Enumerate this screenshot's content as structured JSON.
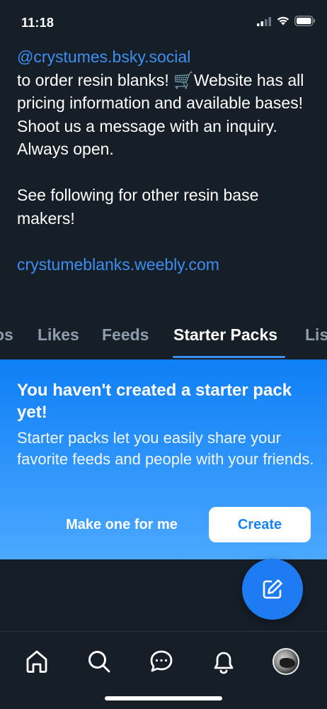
{
  "status_bar": {
    "time": "11:18"
  },
  "bio": {
    "handle_link": "@crystumes.bsky.social",
    "line1": " to order resin blanks! 🛒Website has all pricing information and available bases! Shoot us a message with an inquiry. Always open.",
    "line2": "See following for other resin base makers!",
    "website_link": "crystumeblanks.weebly.com"
  },
  "tabs": [
    {
      "label": "os"
    },
    {
      "label": "Likes"
    },
    {
      "label": "Feeds"
    },
    {
      "label": "Starter Packs"
    },
    {
      "label": "Lis"
    }
  ],
  "starter_pack_card": {
    "title": "You haven't created a starter pack yet!",
    "description": "Starter packs let you easily share your favorite feeds and people with your friends.",
    "secondary_button": "Make one for me",
    "primary_button": "Create"
  },
  "colors": {
    "background": "#161e27",
    "accent": "#3c8ff1",
    "muted_tab": "#8e9cad"
  },
  "bottom_nav": {
    "items": [
      {
        "icon": "home-icon"
      },
      {
        "icon": "search-icon"
      },
      {
        "icon": "chat-icon"
      },
      {
        "icon": "bell-icon"
      },
      {
        "icon": "avatar"
      }
    ]
  }
}
